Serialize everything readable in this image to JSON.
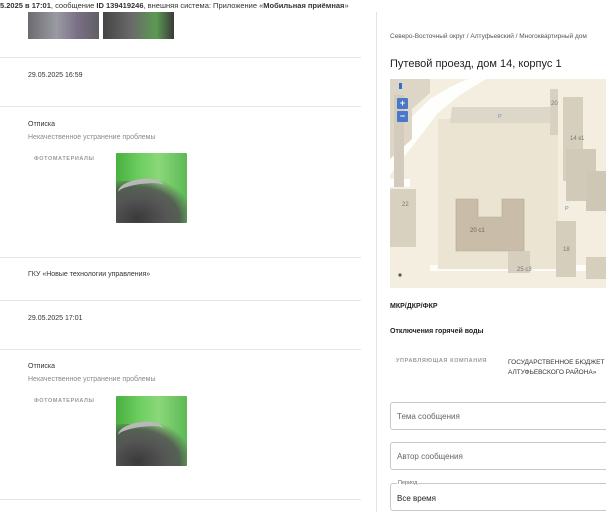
{
  "topbar": {
    "date_prefix": "5.2025 в ",
    "time": "17:01",
    "mid": ", сообщение ",
    "message_id": "ID 139419246",
    "system_prefix": ", внешняя система: Приложение «",
    "system_name": "Мобильная приёмная",
    "system_suffix": "»"
  },
  "feed": {
    "entry1_date": "29.05.2025 16:59",
    "entry2_title": "Отписка",
    "entry2_sub": "Некачественное устранение проблемы",
    "photos_label": "ФОТОМАТЕРИАЛЫ",
    "org_name": "ГКУ «Новые технологии управления»",
    "entry3_date": "29.05.2025 17:01",
    "entry4_title": "Отписка",
    "entry4_sub": "Некачественное устранение проблемы",
    "photos_label2": "ФОТОМАТЕРИАЛЫ"
  },
  "details": {
    "breadcrumb": "Северо-Восточный округ / Алтуфьевский / Многоквартирный дом",
    "address": "Путевой проезд, дом 14, корпус 1",
    "map": {
      "zoom_in": "+",
      "zoom_out": "−",
      "labels": {
        "b20": "20",
        "b14k1": "14 к1",
        "b22": "22",
        "b20c1": "20 с1",
        "b18": "18",
        "b25c3": "25 с3",
        "p1": "P",
        "p2": "P"
      }
    },
    "category": "МКР/ДКР/ФКР",
    "problem": "Отключения горячей воды",
    "mgmt_label": "УПРАВЛЯЮЩАЯ КОМПАНИЯ",
    "mgmt_value_line1": "ГОСУДАРСТВЕННОЕ БЮДЖЕТ",
    "mgmt_value_line2": "АЛТУФЬЕВСКОГО РАЙОНА»"
  },
  "filters": {
    "subject_placeholder": "Тема сообщения",
    "author_placeholder": "Автор сообщения",
    "period_label": "Период",
    "period_value": "Все время"
  }
}
